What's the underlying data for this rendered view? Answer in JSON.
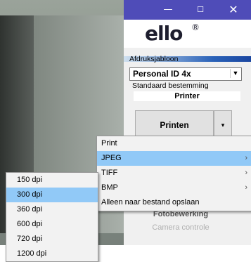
{
  "window": {
    "min_symbol": "—",
    "max_symbol": "☐",
    "close_symbol": "✕",
    "titlebar_color": "#4f4cb8"
  },
  "logo": {
    "text": "ello",
    "registered": "®"
  },
  "template": {
    "label": "Afdruksjabloon",
    "selected": "Personal ID 4x",
    "dest_label": "Standaard bestemming",
    "dest_value": "Printer"
  },
  "print_button": {
    "label": "Printen",
    "arrow": "▾"
  },
  "partial_button": {
    "label": "Fotobewerking"
  },
  "camera_button": {
    "label": "Camera controle"
  },
  "context_menu": {
    "items": [
      {
        "label": "Print",
        "has_submenu": false
      },
      {
        "label": "JPEG",
        "has_submenu": true,
        "highlighted": true
      },
      {
        "label": "TIFF",
        "has_submenu": true
      },
      {
        "label": "BMP",
        "has_submenu": true
      },
      {
        "label": "Alleen naar bestand opslaan",
        "has_submenu": false
      }
    ],
    "submenu_arrow": "›"
  },
  "dpi_menu": {
    "items": [
      "150 dpi",
      "300 dpi",
      "360 dpi",
      "600 dpi",
      "720 dpi",
      "1200 dpi"
    ],
    "highlighted": "300 dpi"
  },
  "colors": {
    "highlight": "#91c9f7"
  }
}
